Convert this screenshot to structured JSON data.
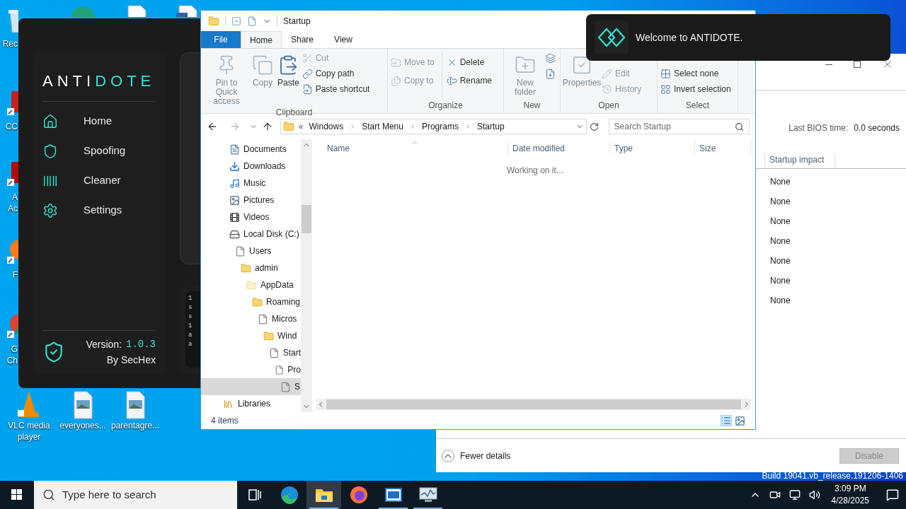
{
  "desktop": {
    "icons": [
      {
        "kind": "recycle",
        "lines": [
          "Rec"
        ]
      },
      {
        "kind": "edge"
      },
      {
        "kind": "doc"
      },
      {
        "kind": "word"
      },
      {
        "kind": "shortcut-red",
        "lines": [
          "CC"
        ]
      },
      {
        "kind": "acrobat",
        "lines": [
          "A",
          "Ac"
        ]
      },
      {
        "kind": "firefox",
        "lines": [
          "F"
        ]
      },
      {
        "kind": "chrome",
        "lines": [
          "G",
          "Ch"
        ]
      },
      {
        "kind": "vlc",
        "lines": [
          "VLC media",
          "player"
        ]
      },
      {
        "kind": "image",
        "lines": [
          "everyones..."
        ]
      },
      {
        "kind": "image",
        "lines": [
          "parentagre..."
        ]
      }
    ],
    "build_text": "Build 19041.vb_release.191206-1406"
  },
  "antidote": {
    "logo_left": "ANTI",
    "logo_right": "DOTE",
    "nav": [
      {
        "kind": "home",
        "label": "Home"
      },
      {
        "kind": "shield",
        "label": "Spoofing"
      },
      {
        "kind": "barcode",
        "label": "Cleaner"
      },
      {
        "kind": "gear",
        "label": "Settings"
      }
    ],
    "version_label": "Version:",
    "version": "1.0.3",
    "author": "By SecHex",
    "console_lines": [
      "1",
      "s",
      "s",
      "1",
      "a",
      "a"
    ]
  },
  "explorer": {
    "title": "Startup",
    "tabs": [
      {
        "label": "File",
        "kind": "file",
        "selected": false
      },
      {
        "label": "Home",
        "kind": "tab",
        "selected": true
      },
      {
        "label": "Share",
        "kind": "tab",
        "selected": false
      },
      {
        "label": "View",
        "kind": "tab",
        "selected": false
      }
    ],
    "ribbon": [
      {
        "label": "Clipboard",
        "items": [
          {
            "kind": "large",
            "label": "Pin to Quick access",
            "disabled": true
          },
          {
            "kind": "large",
            "label": "Copy",
            "disabled": true
          },
          {
            "kind": "large",
            "label": "Paste",
            "disabled": false
          },
          {
            "kind": "small",
            "label": "Cut",
            "disabled": true
          },
          {
            "kind": "small",
            "label": "Copy path",
            "disabled": false
          },
          {
            "kind": "small",
            "label": "Paste shortcut",
            "disabled": false
          }
        ]
      },
      {
        "label": "Organize",
        "items": [
          {
            "kind": "small",
            "label": "Move to",
            "disabled": true
          },
          {
            "kind": "small",
            "label": "Copy to",
            "disabled": true
          },
          {
            "kind": "small",
            "label": "Delete",
            "disabled": false
          },
          {
            "kind": "small",
            "label": "Rename",
            "disabled": false
          }
        ]
      },
      {
        "label": "New",
        "items": [
          {
            "kind": "large",
            "label": "New folder",
            "disabled": true
          },
          {
            "kind": "small",
            "disabled": false
          },
          {
            "kind": "small",
            "disabled": false
          }
        ]
      },
      {
        "label": "Open",
        "items": [
          {
            "kind": "large",
            "label": "Properties",
            "disabled": true
          },
          {
            "kind": "small",
            "label": "Edit",
            "disabled": true
          },
          {
            "kind": "small",
            "label": "History",
            "disabled": true
          }
        ]
      },
      {
        "label": "Select",
        "items": [
          {
            "kind": "small",
            "label": "Select none",
            "disabled": false
          },
          {
            "kind": "small",
            "label": "Invert selection",
            "disabled": false
          }
        ]
      }
    ],
    "address": {
      "overflow": "«",
      "crumbs": [
        "Windows",
        "Start Menu",
        "Programs",
        "Startup"
      ]
    },
    "search": {
      "placeholder": "Search Startup"
    },
    "nav_tree": [
      {
        "label": "Documents",
        "kind": "documents",
        "selected": false
      },
      {
        "label": "Downloads",
        "kind": "downloads",
        "selected": false
      },
      {
        "label": "Music",
        "kind": "music",
        "selected": false
      },
      {
        "label": "Pictures",
        "kind": "pictures",
        "selected": false
      },
      {
        "label": "Videos",
        "kind": "videos",
        "selected": false
      },
      {
        "label": "Local Disk (C:)",
        "kind": "drive",
        "selected": false,
        "children": [
          {
            "label": "Users",
            "kind": "file",
            "selected": false,
            "children": [
              {
                "label": "admin",
                "kind": "folder",
                "selected": false,
                "children": [
                  {
                    "label": "AppData",
                    "kind": "hidden-folder",
                    "selected": false,
                    "children": [
                      {
                        "label": "Roaming",
                        "kind": "folder",
                        "selected": false,
                        "children": [
                          {
                            "label": "Micros",
                            "kind": "file",
                            "selected": false,
                            "children": [
                              {
                                "label": "Wind",
                                "kind": "folder",
                                "selected": false,
                                "children": [
                                  {
                                    "label": "Start",
                                    "kind": "file",
                                    "selected": false,
                                    "children": [
                                      {
                                        "label": "Pro",
                                        "kind": "file",
                                        "selected": false,
                                        "children": [
                                          {
                                            "label": "S",
                                            "kind": "file",
                                            "selected": true
                                          }
                                        ]
                                      }
                                    ]
                                  }
                                ]
                              }
                            ]
                          }
                        ]
                      }
                    ]
                  }
                ]
              }
            ]
          }
        ]
      }
    ],
    "libraries": {
      "label": "Libraries",
      "kind": "libraries",
      "selected": false
    },
    "columns": [
      "Name",
      "Date modified",
      "Type",
      "Size"
    ],
    "message": "Working on it...",
    "status": "4 items"
  },
  "task_manager": {
    "bios_label": "Last BIOS time:",
    "bios_value": "0.0 seconds",
    "column": "Startup impact",
    "rows": [
      "None",
      "None",
      "None",
      "None",
      "None",
      "None",
      "None"
    ],
    "fewer_details": "Fewer details",
    "disable_button": {
      "label": "Disable",
      "disabled": true
    }
  },
  "toast": {
    "message": "Welcome to ANTIDOTE."
  },
  "taskbar": {
    "search_placeholder": "Type here to search",
    "apps": [
      {
        "kind": "taskview",
        "active": false,
        "running": false
      },
      {
        "kind": "edge",
        "active": false,
        "running": false
      },
      {
        "kind": "explorer",
        "active": true,
        "running": true
      },
      {
        "kind": "firefox",
        "active": false,
        "running": false
      },
      {
        "kind": "app",
        "active": false,
        "running": true
      },
      {
        "kind": "monitor",
        "active": false,
        "running": true
      }
    ],
    "time": "3:09 PM",
    "date": "4/28/2025"
  }
}
